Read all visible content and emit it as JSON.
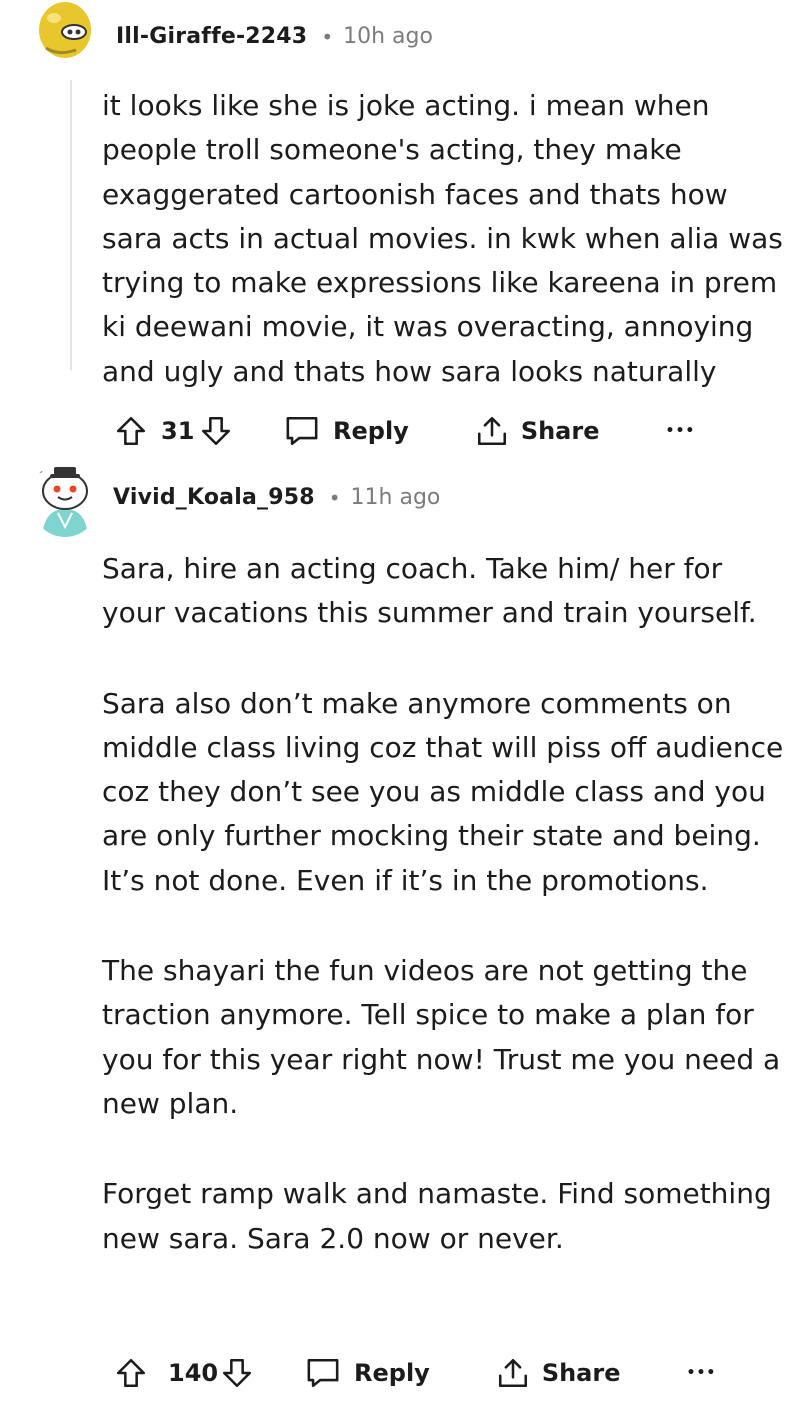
{
  "comments": [
    {
      "username": "Ill-Giraffe-2243",
      "separator": "•",
      "time": "10h ago",
      "paragraphs": [
        "it looks like she is joke acting. i mean when people troll someone's acting, they make exaggerated cartoonish faces and thats how sara acts in actual movies. in kwk when alia was trying to make expressions like kareena in prem ki deewani movie, it was overacting, annoying and ugly and thats how sara looks naturally"
      ],
      "votes": "31",
      "reply_label": "Reply",
      "share_label": "Share",
      "more_label": "•••"
    },
    {
      "username": "Vivid_Koala_958",
      "separator": "•",
      "time": "11h ago",
      "paragraphs": [
        "Sara, hire an acting coach. Take him/ her for your vacations this summer and train yourself.",
        "Sara also don’t make anymore comments on middle class living coz that will piss off audience coz they don’t see you as middle class and you are only further mocking their state and being. It’s not done. Even if it’s in the promotions.",
        "The shayari the fun videos are not getting the traction anymore. Tell spice to make a plan for you for this year right now! Trust me you need a new plan.",
        "Forget ramp walk and namaste. Find something new sara. Sara 2.0 now or never."
      ],
      "votes": "140",
      "reply_label": "Reply",
      "share_label": "Share",
      "more_label": "•••"
    }
  ],
  "icons": {
    "upvote": "upvote-arrow-icon",
    "downvote": "downvote-arrow-icon",
    "reply": "speech-bubble-icon",
    "share": "share-arrow-icon",
    "more": "ellipsis-icon"
  },
  "colors": {
    "text": "#1c1c1c",
    "muted": "#7c7c7c",
    "avatar1": "#e8c62e",
    "avatar2": "#7fd4d0"
  }
}
